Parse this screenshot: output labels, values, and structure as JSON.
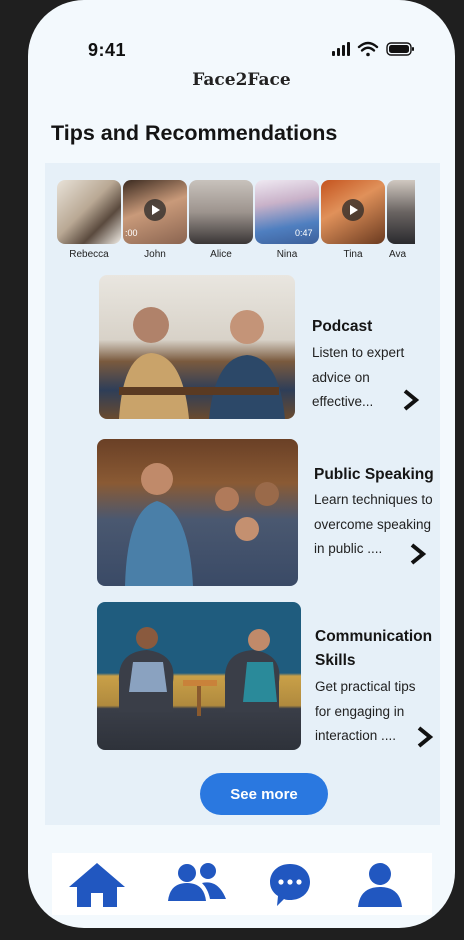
{
  "status": {
    "time": "9:41"
  },
  "app": {
    "title": "Face2Face"
  },
  "section": {
    "title": "Tips and Recommendations"
  },
  "stories": [
    {
      "name": "Rebecca",
      "has_video": false,
      "duration": ""
    },
    {
      "name": "John",
      "has_video": true,
      "duration": ":00"
    },
    {
      "name": "Alice",
      "has_video": false,
      "duration": ""
    },
    {
      "name": "Nina",
      "has_video": false,
      "duration": "0:47"
    },
    {
      "name": "Tina",
      "has_video": true,
      "duration": ""
    },
    {
      "name": "Ava",
      "has_video": false,
      "duration": ""
    }
  ],
  "cards": [
    {
      "title": "Podcast",
      "desc_lines": [
        "Listen to expert",
        "advice  on",
        "effective..."
      ]
    },
    {
      "title": "Public Speaking",
      "desc_lines": [
        "Learn techniques to",
        "overcome speaking",
        "in public ...."
      ]
    },
    {
      "title_lines": [
        "Communication",
        "Skills"
      ],
      "desc_lines": [
        "Get practical tips",
        "for engaging in",
        "interaction ...."
      ]
    }
  ],
  "buttons": {
    "see_more": "See more"
  },
  "nav": {
    "items": [
      {
        "icon": "home-icon",
        "active": true
      },
      {
        "icon": "people-icon",
        "active": false
      },
      {
        "icon": "chat-icon",
        "active": false
      },
      {
        "icon": "profile-icon",
        "active": false
      }
    ]
  },
  "colors": {
    "accent": "#2a78e0",
    "nav_icon": "#2157c0",
    "background": "#f3f9fd",
    "content_bg": "#e6f0f8"
  }
}
